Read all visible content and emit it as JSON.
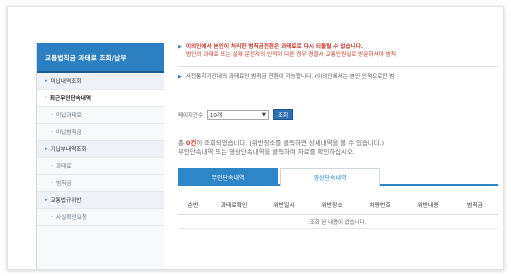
{
  "sidebar": {
    "title": "교통법칙금 과태료 조회/납부",
    "items": [
      {
        "label": "미납내역조회",
        "kind": "group"
      },
      {
        "label": "최근무인단속내역",
        "kind": "active"
      },
      {
        "label": "미납과태료",
        "kind": "sub"
      },
      {
        "label": "미납범칙금",
        "kind": "sub"
      },
      {
        "label": "기납부내역조회",
        "kind": "group"
      },
      {
        "label": "과태료",
        "kind": "sub"
      },
      {
        "label": "범칙금",
        "kind": "sub"
      },
      {
        "label": "교통법규위반",
        "kind": "group"
      },
      {
        "label": "사실확인요청",
        "kind": "sub"
      }
    ]
  },
  "notice": {
    "line1": "이의인에서 본인이 처리한 범칙금전환은 과태료로 다시 되돌릴 수 없습니다.",
    "line2": "범인의 과태료 또는 실제 운전자의 인적이 다른 경우 경찰서 교통민원실로 방문하셔야 범칙",
    "line3": "사전통지기간내의 과태료만 범칙금 전환이 가능합니다. (이의인에서는 본인 인적으로만 범"
  },
  "controls": {
    "page_size_label": "페이지건수",
    "page_size_value": "10개",
    "search_button": "조회"
  },
  "result": {
    "prefix": "총 ",
    "count": "0건",
    "line1_rest": "이 조회되었습니다. (위반장소를 클릭하면 상세내역을 볼 수 있습니다.)",
    "line2": "무인단속내역 또는 영상단속내역을 클릭하여 자료를 확인하십시오."
  },
  "tabs": [
    {
      "label": "무인단속내역",
      "active": true
    },
    {
      "label": "영상단속내역",
      "active": false
    }
  ],
  "table": {
    "headers": [
      "순번",
      "과태료확인",
      "위반일시",
      "위반장소",
      "차량번호",
      "위반내용",
      "범칙금"
    ],
    "empty_message": "조회 된 내용이 없습니다."
  },
  "colors": {
    "accent": "#2d86c8",
    "sidebar_header": "#2c7fc1",
    "notice_red": "#c23a2a",
    "count_red": "#d2412e"
  }
}
